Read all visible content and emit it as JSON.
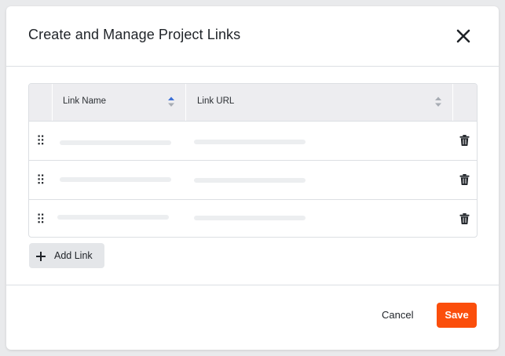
{
  "modal": {
    "title": "Create and Manage Project Links",
    "close_icon": "close-icon"
  },
  "table": {
    "columns": [
      {
        "label": "Link Name",
        "sort_icon": "sort-icon"
      },
      {
        "label": "Link URL",
        "sort_icon": "sort-icon"
      }
    ],
    "rows": [
      {
        "drag_icon": "drag-handle-icon",
        "delete_icon": "trash-icon",
        "name": "",
        "url": ""
      },
      {
        "drag_icon": "drag-handle-icon",
        "delete_icon": "trash-icon",
        "name": "",
        "url": ""
      },
      {
        "drag_icon": "drag-handle-icon",
        "delete_icon": "trash-icon",
        "name": "",
        "url": ""
      }
    ]
  },
  "actions": {
    "add_link_label": "Add Link",
    "add_icon": "plus-icon",
    "cancel_label": "Cancel",
    "save_label": "Save"
  },
  "colors": {
    "accent": "#fb4e0b",
    "sort_active": "#3b6fd6",
    "sort_inactive": "#a7acb3"
  }
}
